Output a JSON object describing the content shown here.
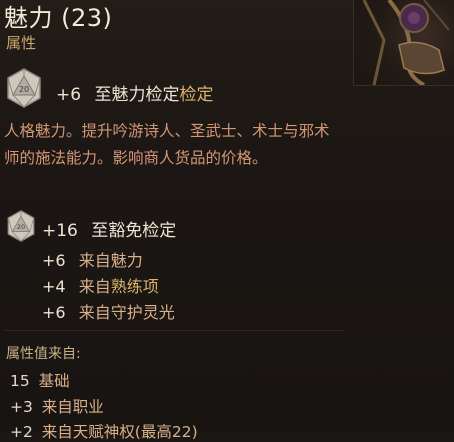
{
  "header": {
    "title": "魅力 (23)",
    "subtitle": "属性"
  },
  "check": {
    "bonus": "+6",
    "text_plain": "至魅力检定",
    "text_gold": "检定",
    "die_value": "20"
  },
  "description": "人格魅力。提升吟游诗人、圣武士、术士与邪术师的施法能力。影响商人货品的价格。",
  "save": {
    "bonus": "+16",
    "text": "至豁免检定",
    "die_value": "20",
    "breakdown": [
      {
        "bonus": "+6",
        "prefix": "来自",
        "source": "魅力",
        "gold": false
      },
      {
        "bonus": "+4",
        "prefix": "来自",
        "source": "熟练项",
        "gold": true
      },
      {
        "bonus": "+6",
        "prefix": "来自",
        "source": "守护灵光",
        "gold": false
      }
    ]
  },
  "sources": {
    "label": "属性值来自:",
    "items": [
      {
        "value": "15",
        "text": "基础"
      },
      {
        "value": "+3",
        "text": "来自职业"
      },
      {
        "value": "+2",
        "text": "来自天赋神权(最高22)"
      }
    ]
  },
  "colors": {
    "background": "#1b1714",
    "title": "#f3ead8",
    "gold": "#d9b36b",
    "description": "#d59675",
    "subtitle": "#c9a86a"
  },
  "icons": [
    "d20-die-icon",
    "character-portrait"
  ]
}
